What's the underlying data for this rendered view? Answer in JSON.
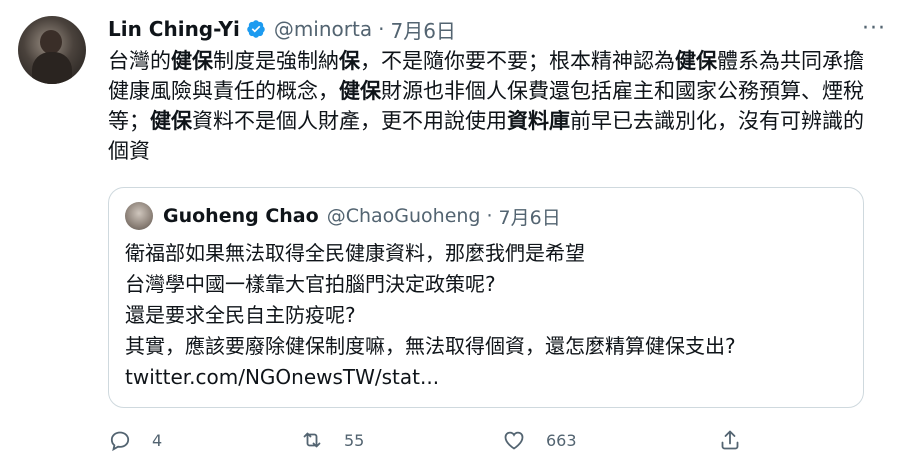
{
  "tweet": {
    "author_name": "Lin Ching-Yi",
    "handle": "@minorta",
    "date": "7月6日",
    "segments": [
      {
        "text": "台灣的",
        "bold": false
      },
      {
        "text": "健保",
        "bold": true
      },
      {
        "text": "制度是強制納",
        "bold": false
      },
      {
        "text": "保",
        "bold": true
      },
      {
        "text": "，不是隨你要不要；根本精神認為",
        "bold": false
      },
      {
        "text": "健保",
        "bold": true
      },
      {
        "text": "體系為共同承擔健康風險與責任的概念，",
        "bold": false
      },
      {
        "text": "健保",
        "bold": true
      },
      {
        "text": "財源也非個人保費還包括雇主和國家公務預算、煙稅等；",
        "bold": false
      },
      {
        "text": "健保",
        "bold": true
      },
      {
        "text": "資料不是個人財產，更不用說使用",
        "bold": false
      },
      {
        "text": "資料庫",
        "bold": true
      },
      {
        "text": "前早已去識別化，沒有可辨識的個資",
        "bold": false
      }
    ]
  },
  "quote": {
    "author_name": "Guoheng Chao",
    "handle": "@ChaoGuoheng",
    "date": "7月6日",
    "lines": [
      "衛福部如果無法取得全民健康資料，那麼我們是希望",
      "台灣學中國一樣靠大官拍腦門決定政策呢?",
      "還是要求全民自主防疫呢?",
      "其實，應該要廢除健保制度嘛，無法取得個資，還怎麼精算健保支出?",
      "twitter.com/NGOnewsTW/stat..."
    ]
  },
  "actions": {
    "reply_count": "4",
    "retweet_count": "55",
    "like_count": "663"
  },
  "colors": {
    "verified": "#1d9bf0",
    "secondary_text": "#536471",
    "border": "#cfd9de"
  }
}
